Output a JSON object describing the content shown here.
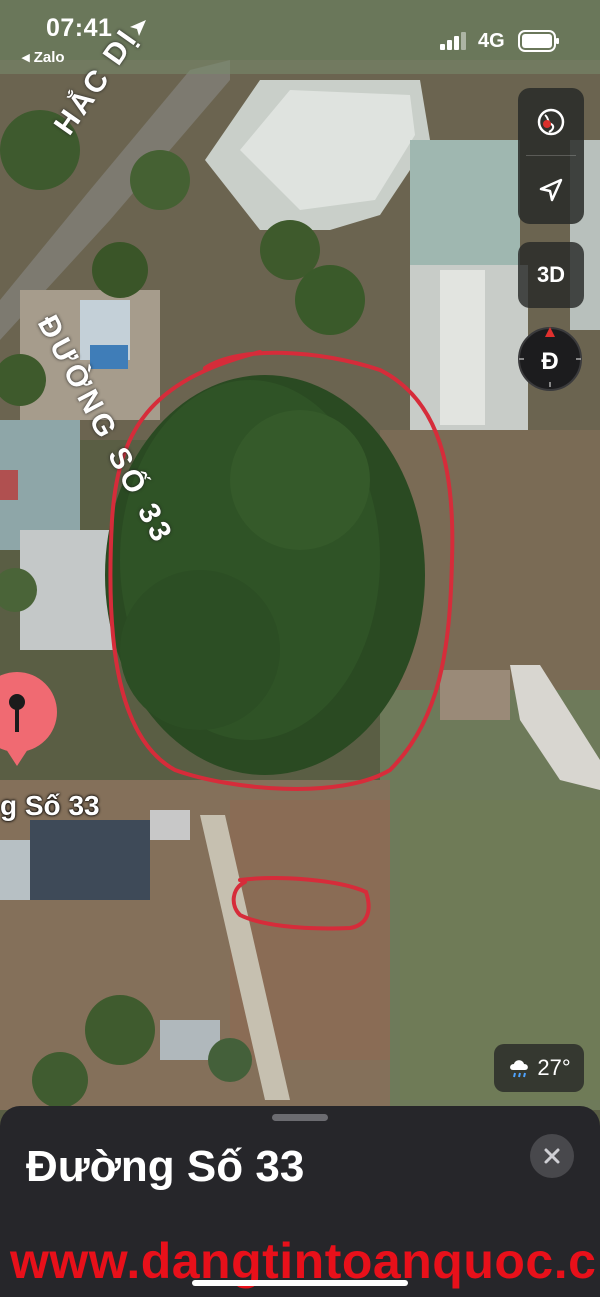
{
  "status_bar": {
    "time": "07:41",
    "back_app": "Zalo",
    "network": "4G"
  },
  "map": {
    "road_label_1": "HẮC DỊ",
    "road_label_2": "ĐƯỜNG SỐ 33",
    "pin_label": "g Số 33",
    "annotation_color": "#d62c3a"
  },
  "controls": {
    "globe_icon": "globe-icon",
    "location_icon": "location-arrow-icon",
    "three_d_label": "3D",
    "compass_label": "Đ"
  },
  "weather": {
    "icon": "cloud-rain-icon",
    "temperature": "27°"
  },
  "place_card": {
    "title": "Đường Số 33",
    "close_icon": "close-icon"
  },
  "watermark": "www.dangtintoanquoc.c"
}
